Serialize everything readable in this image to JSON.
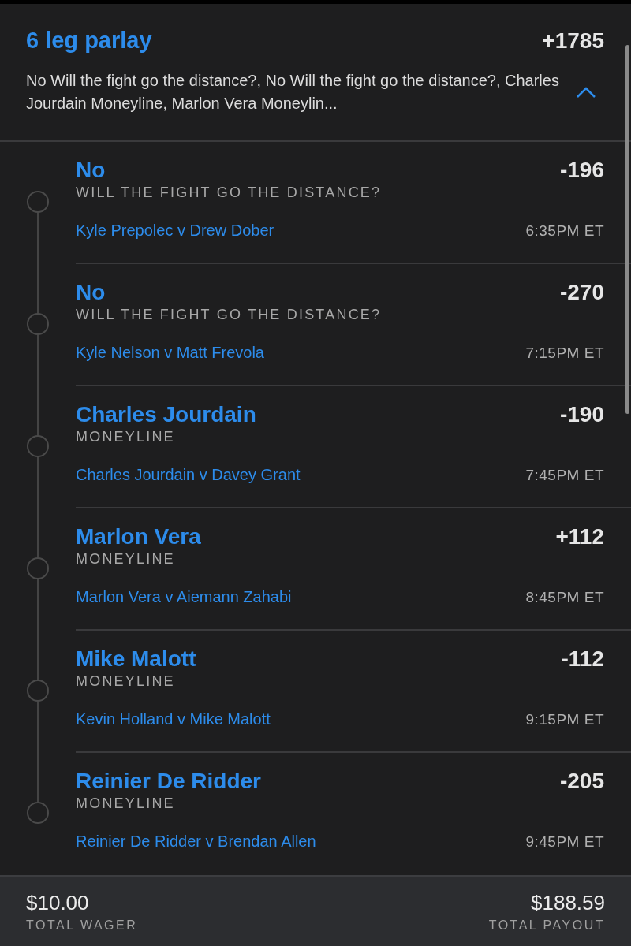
{
  "parlay": {
    "title": "6 leg parlay",
    "odds": "+1785",
    "summary": "No Will the fight go the distance?, No Will the fight go the distance?, Charles Jourdain Moneyline, Marlon Vera Moneylin...",
    "expanded": true
  },
  "legs": [
    {
      "pick": "No",
      "odds": "-196",
      "market": "WILL THE FIGHT GO THE DISTANCE?",
      "matchup": "Kyle Prepolec v Drew Dober",
      "time": "6:35PM ET"
    },
    {
      "pick": "No",
      "odds": "-270",
      "market": "WILL THE FIGHT GO THE DISTANCE?",
      "matchup": "Kyle Nelson v Matt Frevola",
      "time": "7:15PM ET"
    },
    {
      "pick": "Charles Jourdain",
      "odds": "-190",
      "market": "MONEYLINE",
      "matchup": "Charles Jourdain v Davey Grant",
      "time": "7:45PM ET"
    },
    {
      "pick": "Marlon Vera",
      "odds": "+112",
      "market": "MONEYLINE",
      "matchup": "Marlon Vera v Aiemann Zahabi",
      "time": "8:45PM ET"
    },
    {
      "pick": "Mike Malott",
      "odds": "-112",
      "market": "MONEYLINE",
      "matchup": "Kevin Holland v Mike Malott",
      "time": "9:15PM ET"
    },
    {
      "pick": "Reinier De Ridder",
      "odds": "-205",
      "market": "MONEYLINE",
      "matchup": "Reinier De Ridder v Brendan Allen",
      "time": "9:45PM ET"
    }
  ],
  "footer": {
    "wager": "$10.00",
    "wager_label": "TOTAL WAGER",
    "payout": "$188.59",
    "payout_label": "TOTAL PAYOUT"
  }
}
